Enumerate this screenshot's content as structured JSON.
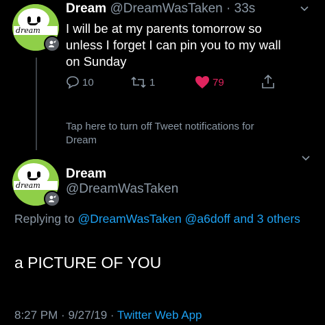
{
  "tweet1": {
    "display_name": "Dream",
    "handle": "@DreamWasTaken",
    "separator": "·",
    "time": "33s",
    "text": "I will be at my parents tomorrow so unless I forget I can pin you to my wall on Sunday",
    "reply_count": "10",
    "retweet_count": "1",
    "like_count": "79"
  },
  "avatar_logo_text": "dream",
  "notification": "Tap here to turn off Tweet notifications for Dream",
  "tweet2": {
    "display_name": "Dream",
    "handle": "@DreamWasTaken",
    "replying_prefix": "Replying to",
    "replying_user1": "@DreamWasTaken",
    "replying_user2": "@a6doff",
    "replying_and": "and",
    "replying_others": "3 others",
    "text": "a PICTURE OF YOU",
    "time": "8:27 PM",
    "date": "9/27/19",
    "dot": "·",
    "source": "Twitter Web App"
  },
  "colors": {
    "background": "#000000",
    "muted": "#8b98a5",
    "link": "#1da1f2",
    "like": "#e0245e",
    "avatar_green": "#8fcf48"
  },
  "icons": [
    "reply-icon",
    "retweet-icon",
    "heart-icon",
    "share-icon",
    "chevron-down-icon",
    "verified-badge-icon"
  ]
}
